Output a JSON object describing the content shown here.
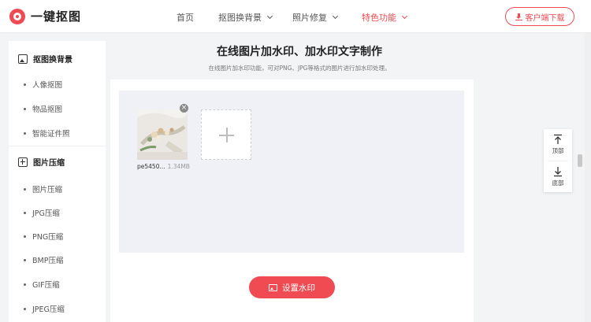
{
  "brand": {
    "name": "一键抠图",
    "color": "#f04a52"
  },
  "nav": {
    "items": [
      {
        "label": "首页",
        "dropdown": false,
        "active": false
      },
      {
        "label": "抠图换背景",
        "dropdown": true,
        "active": false
      },
      {
        "label": "照片修复",
        "dropdown": true,
        "active": false
      },
      {
        "label": "特色功能",
        "dropdown": true,
        "active": true
      }
    ],
    "download_label": "客户端下载"
  },
  "sidebar": {
    "groups": [
      {
        "title": "抠图换背景",
        "icon": "image-icon",
        "items": [
          "人像抠图",
          "物品抠图",
          "智能证件照"
        ]
      },
      {
        "title": "图片压缩",
        "icon": "compress-icon",
        "items": [
          "图片压缩",
          "JPG压缩",
          "PNG压缩",
          "BMP压缩",
          "GIF压缩",
          "JPEG压缩"
        ]
      }
    ]
  },
  "main": {
    "title": "在线图片加水印、加水印文字制作",
    "subtitle": "在线图片加水印功能，可对PNG、JPG等格式的图片进行加水印处理。",
    "file": {
      "name": "pe5450...",
      "size": "1.34MB"
    },
    "action_label": "设置水印"
  },
  "float_tools": {
    "top_label": "顶部",
    "bottom_label": "底部"
  }
}
